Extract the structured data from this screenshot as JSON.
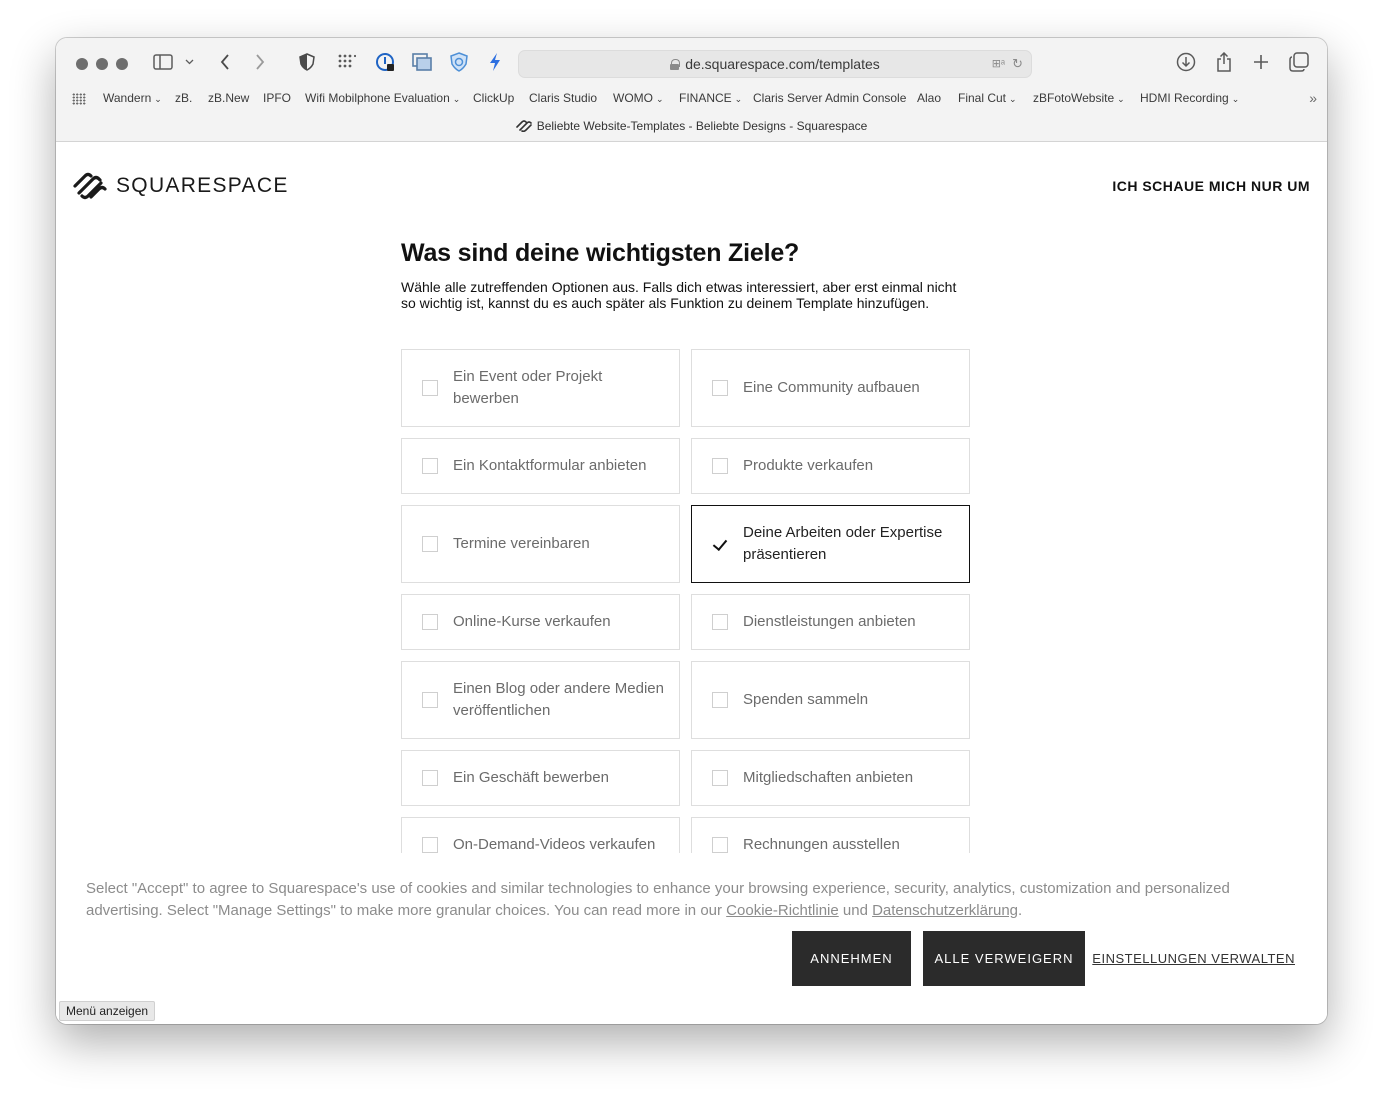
{
  "browser": {
    "url": "de.squarespace.com/templates",
    "tab_title": "Beliebte Website-Templates - Beliebte Designs - Squarespace",
    "bookmarks": [
      {
        "label": "Wandern",
        "chevron": true
      },
      {
        "label": "zB.",
        "chevron": false
      },
      {
        "label": "zB.New",
        "chevron": false
      },
      {
        "label": "IPFO",
        "chevron": false
      },
      {
        "label": "Wifi Mobilphone Evaluation",
        "chevron": true
      },
      {
        "label": "ClickUp",
        "chevron": false
      },
      {
        "label": "Claris Studio",
        "chevron": false
      },
      {
        "label": "WOMO",
        "chevron": true
      },
      {
        "label": "FINANCE",
        "chevron": true
      },
      {
        "label": "Claris Server Admin Console",
        "chevron": false
      },
      {
        "label": "Alao",
        "chevron": false
      },
      {
        "label": "Final Cut",
        "chevron": true
      },
      {
        "label": "zBFotoWebsite",
        "chevron": true
      },
      {
        "label": "HDMI Recording",
        "chevron": true
      }
    ],
    "menu_tooltip": "Menü anzeigen"
  },
  "header": {
    "logo_text": "SQUARESPACE",
    "browse_link": "ICH SCHAUE MICH NUR UM"
  },
  "question": {
    "title": "Was sind deine wichtigsten Ziele?",
    "description": "Wähle alle zutreffenden Optionen aus. Falls dich etwas interessiert, aber erst einmal nicht so wichtig ist, kannst du es auch später als Funktion zu deinem Template hinzufügen."
  },
  "options": [
    {
      "label": "Ein Event oder Projekt bewerben",
      "checked": false
    },
    {
      "label": "Eine Community aufbauen",
      "checked": false
    },
    {
      "label": "Ein Kontaktformular anbieten",
      "checked": false
    },
    {
      "label": "Produkte verkaufen",
      "checked": false
    },
    {
      "label": "Termine vereinbaren",
      "checked": false
    },
    {
      "label": "Deine Arbeiten oder Expertise präsentieren",
      "checked": true
    },
    {
      "label": "Online-Kurse verkaufen",
      "checked": false
    },
    {
      "label": "Dienstleistungen anbieten",
      "checked": false
    },
    {
      "label": "Einen Blog oder andere Medien veröffentlichen",
      "checked": false
    },
    {
      "label": "Spenden sammeln",
      "checked": false
    },
    {
      "label": "Ein Geschäft bewerben",
      "checked": false
    },
    {
      "label": "Mitgliedschaften anbieten",
      "checked": false
    },
    {
      "label": "On-Demand-Videos verkaufen",
      "checked": false
    },
    {
      "label": "Rechnungen ausstellen",
      "checked": false
    }
  ],
  "cookie": {
    "text_1": "Select \"Accept\" to agree to Squarespace's use of cookies and similar technologies to enhance your browsing experience, security, analytics, customization and personalized advertising. Select \"Manage Settings\" to make more granular choices. You can read more in our ",
    "link_cookie": "Cookie-Richtlinie",
    "text_and": " und ",
    "link_privacy": "Datenschutzerklärung",
    "text_end": ".",
    "accept_label": "ANNEHMEN",
    "reject_label": "ALLE VERWEIGERN",
    "settings_label": "EINSTELLUNGEN VERWALTEN"
  }
}
